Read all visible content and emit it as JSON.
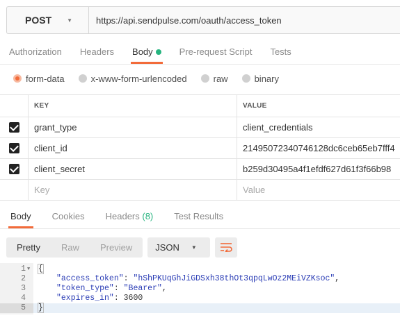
{
  "request": {
    "method": "POST",
    "url": "https://api.sendpulse.com/oauth/access_token"
  },
  "request_tabs": [
    {
      "label": "Authorization",
      "active": false
    },
    {
      "label": "Headers",
      "active": false
    },
    {
      "label": "Body",
      "active": true
    },
    {
      "label": "Pre-request Script",
      "active": false
    },
    {
      "label": "Tests",
      "active": false
    }
  ],
  "body_modes": [
    {
      "label": "form-data",
      "selected": true
    },
    {
      "label": "x-www-form-urlencoded",
      "selected": false
    },
    {
      "label": "raw",
      "selected": false
    },
    {
      "label": "binary",
      "selected": false
    }
  ],
  "params_table": {
    "headers": {
      "key": "KEY",
      "value": "VALUE"
    },
    "rows": [
      {
        "key": "grant_type",
        "value": "client_credentials",
        "checked": true
      },
      {
        "key": "client_id",
        "value": "21495072340746128dc6ceb65eb7fff4",
        "checked": true
      },
      {
        "key": "client_secret",
        "value": "b259d30495a4f1efdf627d61f3f66b98",
        "checked": true
      }
    ],
    "placeholder": {
      "key": "Key",
      "value": "Value"
    }
  },
  "response_tabs": {
    "body": "Body",
    "cookies": "Cookies",
    "headers": "Headers",
    "headers_count": "(8)",
    "tests": "Test Results"
  },
  "view_buttons": {
    "pretty": "Pretty",
    "raw": "Raw",
    "preview": "Preview"
  },
  "format": "JSON",
  "response_lines": [
    {
      "n": "1",
      "text": "{"
    },
    {
      "n": "2",
      "key": "\"access_token\"",
      "value": "\"hShPKUqGhJiGDSxh38thOt3qpqLwOz2MEiVZKsoc\"",
      "tail": ","
    },
    {
      "n": "3",
      "key": "\"token_type\"",
      "value": "\"Bearer\"",
      "tail": ","
    },
    {
      "n": "4",
      "key": "\"expires_in\"",
      "value": "3600",
      "tail": ""
    },
    {
      "n": "5",
      "text": "}"
    }
  ],
  "colors": {
    "accent": "#f26b3a",
    "green": "#26b47f",
    "json_string": "#2a3cb5"
  }
}
